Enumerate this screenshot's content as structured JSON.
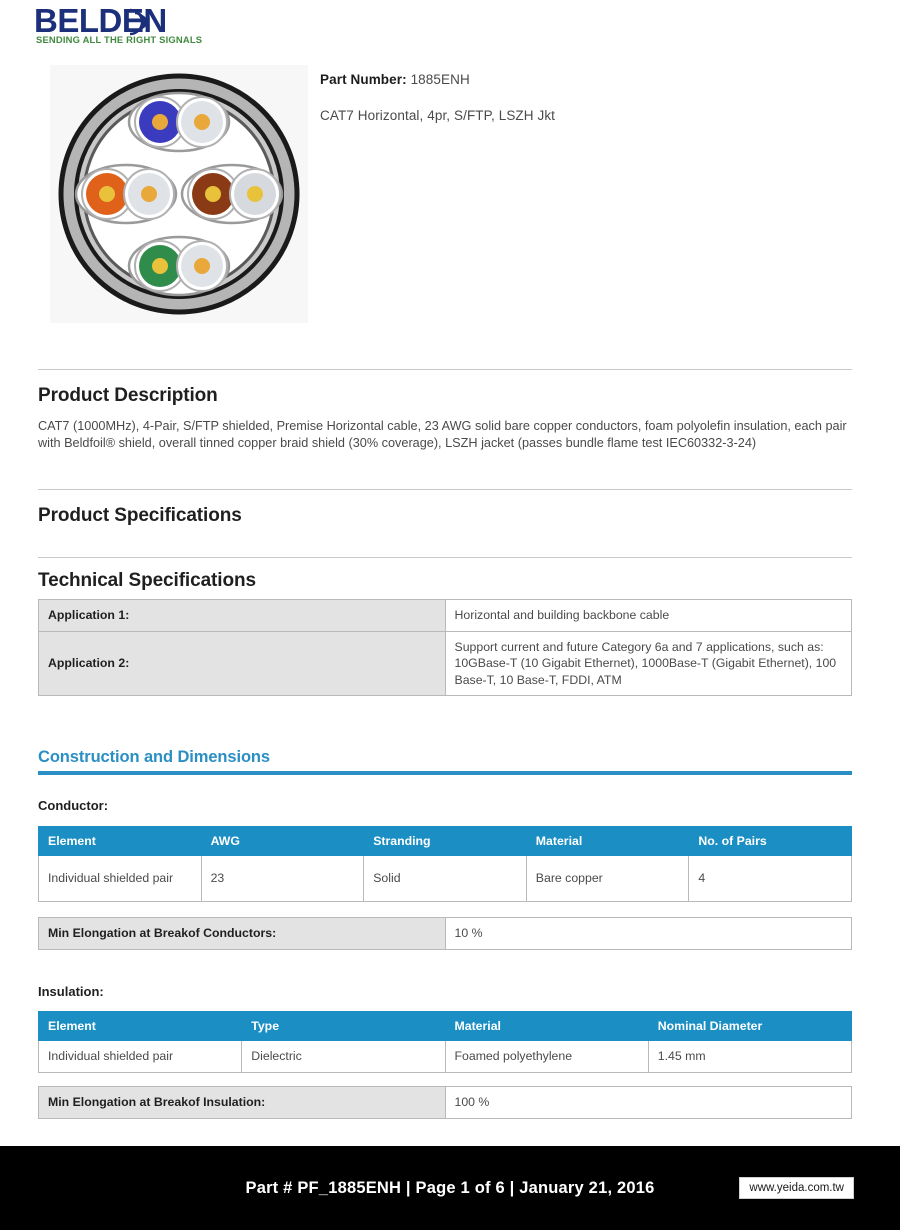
{
  "brand": {
    "name": "BELDEN",
    "tagline": "SENDING ALL THE RIGHT SIGNALS",
    "logo_blue": "#1b2f7a",
    "logo_green": "#3f8a3f"
  },
  "header": {
    "part_number_label": "Part Number:",
    "part_number": "1885ENH",
    "description": "CAT7 Horizontal, 4pr, S/FTP, LSZH Jkt",
    "image_alt": "cable-cross-section"
  },
  "product_description": {
    "heading": "Product Description",
    "body": "CAT7 (1000MHz), 4-Pair, S/FTP shielded, Premise Horizontal cable, 23 AWG solid bare copper conductors, foam polyolefin insulation, each pair with Beldfoil® shield, overall tinned copper braid shield (30% coverage), LSZH jacket (passes bundle flame test IEC60332-3-24)"
  },
  "product_specifications": {
    "heading": "Product Specifications"
  },
  "technical_specifications": {
    "heading": "Technical Specifications",
    "rows": [
      {
        "label": "Application 1:",
        "value": "Horizontal and building backbone cable"
      },
      {
        "label": "Application 2:",
        "value": "Support current and future Category 6a and 7 applications, such as: 10GBase-T (10 Gigabit Ethernet), 1000Base-T (Gigabit Ethernet), 100 Base-T, 10 Base-T, FDDI, ATM"
      }
    ]
  },
  "construction": {
    "heading": "Construction and Dimensions",
    "accent_color": "#2a8fc4",
    "conductor": {
      "subheading": "Conductor:",
      "columns": [
        "Element",
        "AWG",
        "Stranding",
        "Material",
        "No. of Pairs"
      ],
      "rows": [
        [
          "Individual shielded pair",
          "23",
          "Solid",
          "Bare copper",
          "4"
        ]
      ],
      "footer_label": "Min Elongation at Breakof Conductors:",
      "footer_value": "10 %"
    },
    "insulation": {
      "subheading": "Insulation:",
      "columns": [
        "Element",
        "Type",
        "Material",
        "Nominal Diameter"
      ],
      "rows": [
        [
          "Individual shielded pair",
          "Dielectric",
          "Foamed polyethylene",
          "1.45 mm"
        ]
      ],
      "footer_label": "Min Elongation at Breakof Insulation:",
      "footer_value": "100 %"
    }
  },
  "footer": {
    "text": "Part # PF_1885ENH  |  Page 1 of 6  |  January 21, 2016",
    "badge": "www.yeida.com.tw",
    "background": "#000000"
  }
}
